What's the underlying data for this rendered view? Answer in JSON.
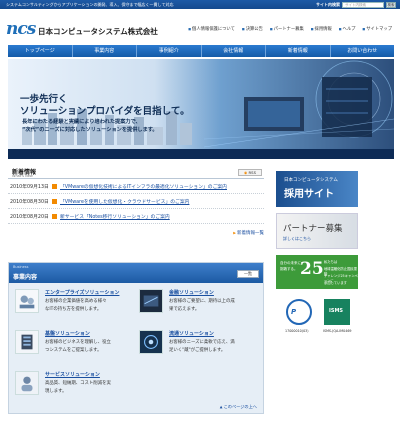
{
  "topbar": {
    "tagline": "システムコンサルティングからアプリケーションの開発、導入、保守まで幅広く一貫して対応",
    "site_search_label": "サイト内検索",
    "search_placeholder": "サイト内検索",
    "search_button": "検索"
  },
  "header": {
    "logo_mark": "ncs",
    "company_name": "日本コンピュータシステム株式会社",
    "utility_links": [
      "個人情報保護について",
      "決算公告",
      "パートナー募集",
      "採用情報",
      "ヘルプ",
      "サイトマップ"
    ]
  },
  "nav": {
    "tabs": [
      "トップページ",
      "事業内容",
      "事例紹介",
      "会社情報",
      "新着情報",
      "お問い合わせ"
    ]
  },
  "hero": {
    "headline_1": "一歩先行く",
    "headline_2": "ソリューションプロバイダを目指して。",
    "body_1": "長年にわたる経験と実績により培われた提案力で、",
    "body_2": "“次代”のニーズに対応したソリューションを提供します。"
  },
  "news": {
    "title": "新着情報",
    "title_en": "What's New",
    "rss_label": "RSS",
    "items": [
      {
        "date": "2010年09月13日",
        "text": "「VMwareの仮想化技術によるITインフラの最適化ソリューション」のご案内"
      },
      {
        "date": "2010年08月30日",
        "text": "「VMwareを使用した仮想化・クラウドサービス」のご案内"
      },
      {
        "date": "2010年08月20日",
        "text": "新サービス「Notes移行ソリューション」のご案内"
      }
    ],
    "more_label": "新着情報一覧"
  },
  "business": {
    "title_en": "Business",
    "title": "事業内容",
    "list_button": "一覧",
    "items": [
      {
        "title": "エンタープライズソリューション",
        "desc_1": "お客様の企業価値を高める様々",
        "desc_2": "なITの持ち方を提供します。"
      },
      {
        "title": "金融ソリューション",
        "desc_1": "お客様のご要望に、期待以上の成",
        "desc_2": "果で応えます。"
      },
      {
        "title": "基盤ソリューション",
        "desc_1": "お客様のビジネスを理解し、役立",
        "desc_2": "つシステムをご提案します。"
      },
      {
        "title": "流通ソリューション",
        "desc_1": "お客様のニーズに柔軟で応え、満",
        "desc_2": "足いく\"蔵\"がご提供します。"
      },
      {
        "title": "サービスソリューション",
        "desc_1": "高品質、短納期、コスト削減を実",
        "desc_2": "現します。"
      }
    ],
    "page_top": "このページの上へ"
  },
  "sidebar": {
    "recruit_small": "日本コンピュータシステム",
    "recruit_main": "採用サイト",
    "partner_main": "パートナー募集",
    "partner_sub": "詳しくはこちら",
    "challenge": {
      "left_1": "自分の未来に",
      "left_2": "挑戦する。",
      "number": "25",
      "right_1": "私たちは",
      "right_2": "地球温暖化防止国民運動",
      "right_3": "チャレンジ25キャンペーンに",
      "right_4": "参加しています"
    },
    "cert_1_mark": "P",
    "cert_1_number": "17000010(03)",
    "cert_2_mark": "ISMS",
    "cert_2_number": "ISMS-JQA-IM0469"
  },
  "colors": {
    "nav_blue": "#145ba8",
    "link_blue": "#1a4fa0",
    "accent_orange": "#f28a00",
    "challenge_green": "#3d9b3a"
  }
}
